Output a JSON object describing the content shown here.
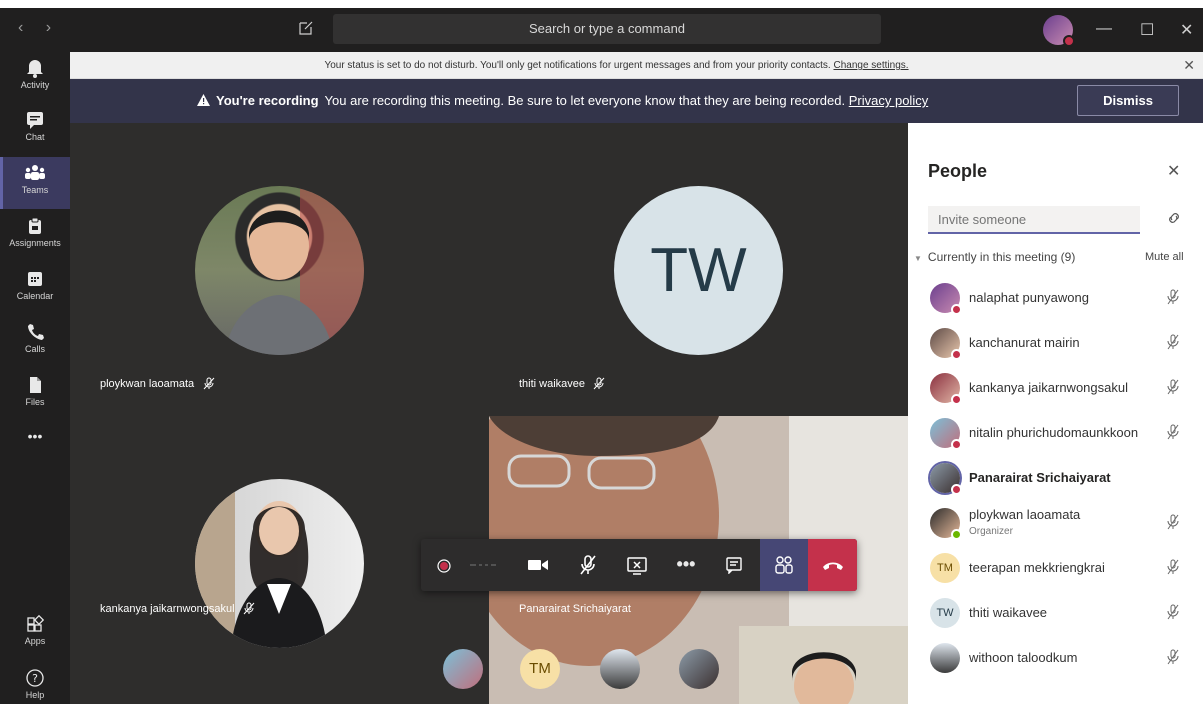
{
  "titlebar": {
    "search_placeholder": "Search or type a command",
    "nav_back": "‹",
    "nav_forward": "›",
    "minimize": "—",
    "maximize": "☐",
    "close": "✕"
  },
  "rail": {
    "items": [
      {
        "label": "Activity",
        "icon": "bell-icon"
      },
      {
        "label": "Chat",
        "icon": "chat-icon"
      },
      {
        "label": "Teams",
        "icon": "teams-icon",
        "active": true
      },
      {
        "label": "Assignments",
        "icon": "assignments-icon"
      },
      {
        "label": "Calendar",
        "icon": "calendar-icon"
      },
      {
        "label": "Calls",
        "icon": "phone-icon"
      },
      {
        "label": "Files",
        "icon": "file-icon"
      }
    ],
    "more": "•••",
    "apps_label": "Apps",
    "help_label": "Help"
  },
  "notice": {
    "text": "Your status is set to do not disturb. You'll only get notifications for urgent messages and from your priority contacts.",
    "link": "Change settings."
  },
  "recording_banner": {
    "title": "You're recording",
    "text": "You are recording this meeting. Be sure to let everyone know that they are being recorded.",
    "link": "Privacy policy",
    "dismiss": "Dismiss"
  },
  "stage": {
    "tiles": [
      {
        "name": "ploykwan laoamata"
      },
      {
        "name": "thiti waikavee",
        "initials": "TW"
      },
      {
        "name": "kankanya jaikarnwongsakul"
      },
      {
        "name": "Panarairat Srichaiyarat"
      }
    ],
    "overflow_initials": "TM"
  },
  "panel": {
    "title": "People",
    "invite_placeholder": "Invite someone",
    "section": "Currently in this meeting (9)",
    "mute_all": "Mute all",
    "people": [
      {
        "name": "nalaphat punyawong",
        "status": "busy"
      },
      {
        "name": "kanchanurat mairin",
        "status": "busy"
      },
      {
        "name": "kankanya jaikarnwongsakul",
        "status": "busy"
      },
      {
        "name": "nitalin phurichudomaunkkoon",
        "status": "busy"
      },
      {
        "name": "Panarairat Srichaiyarat",
        "status": "busy"
      },
      {
        "name": "ploykwan laoamata",
        "role": "Organizer",
        "status": "available"
      },
      {
        "name": "teerapan mekkriengkrai",
        "initials": "TM"
      },
      {
        "name": "thiti waikavee",
        "initials": "TW"
      },
      {
        "name": "withoon taloodkum"
      }
    ]
  },
  "colors": {
    "brand": "#6264a7",
    "hangup": "#c4314b",
    "rail": "#201f1f",
    "banner": "#33344a"
  }
}
